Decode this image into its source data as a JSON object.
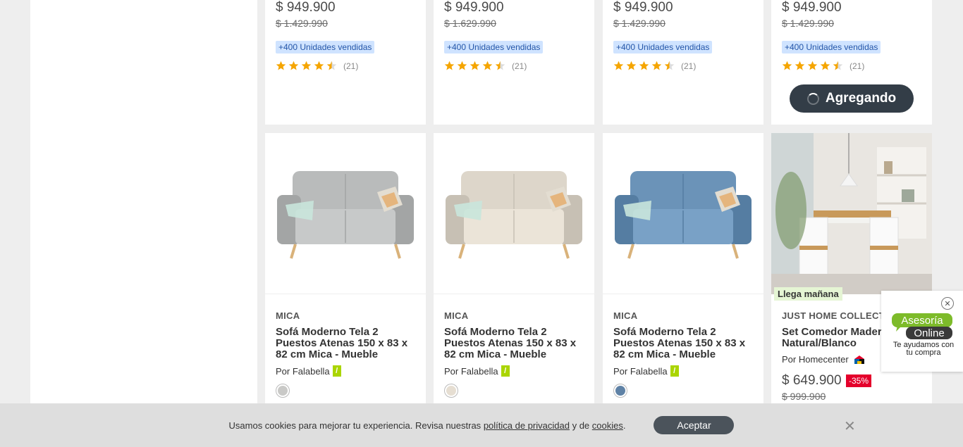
{
  "top_row": [
    {
      "price": "$ 949.900",
      "old_price": "$ 1.429.990",
      "sold_badge": "+400 Unidades vendidas",
      "reviews": "(21)"
    },
    {
      "price": "$ 949.900",
      "old_price": "$ 1.629.990",
      "sold_badge": "+400 Unidades vendidas",
      "reviews": "(21)"
    },
    {
      "price": "$ 949.900",
      "old_price": "$ 1.429.990",
      "sold_badge": "+400 Unidades vendidas",
      "reviews": "(21)"
    },
    {
      "price": "$ 949.900",
      "old_price": "$ 1.429.990",
      "sold_badge": "+400 Unidades vendidas",
      "reviews": "(21)",
      "button_label": "Agregando"
    }
  ],
  "rating": 4.5,
  "bottom_row": [
    {
      "brand": "MICA",
      "title": "Sofá Moderno Tela 2 Puestos Atenas 150 x 83 x 82 cm Mica - Mueble",
      "seller": "Por Falabella",
      "seller_logo": "/",
      "swatch_color": "#c9c9c7",
      "sofa_color": "#b9bbbb"
    },
    {
      "brand": "MICA",
      "title": "Sofá Moderno Tela 2 Puestos Atenas 150 x 83 x 82 cm Mica - Mueble",
      "seller": "Por Falabella",
      "seller_logo": "/",
      "swatch_color": "#e6ded2",
      "sofa_color": "#ddd6ca"
    },
    {
      "brand": "MICA",
      "title": "Sofá Moderno Tela 2 Puestos Atenas 150 x 83 x 82 cm Mica - Mueble",
      "seller": "Por Falabella",
      "seller_logo": "/",
      "swatch_color": "#5f82a6",
      "sofa_color": "#6b93b8"
    },
    {
      "brand": "JUST HOME COLLECTION",
      "title": "Set Comedor Madera Natural/Blanco",
      "seller": "Por Homecenter",
      "delivery": "Llega mañana",
      "price": "$ 649.900",
      "discount": "-35%",
      "old_price": "$ 999.900"
    }
  ],
  "cookie": {
    "text_before": "Usamos cookies para mejorar tu experiencia. Revisa nuestras",
    "privacy_link": "política de privacidad",
    "and": "y de",
    "cookies_link": "cookies",
    "period": ".",
    "accept_label": "Aceptar",
    "close": "✕"
  },
  "chat": {
    "close": "✕",
    "logo_line1": "Asesoría",
    "logo_line2": "Online",
    "text": "Te ayudamos con tu compra"
  },
  "colors": {
    "star": "#f5a500",
    "accent_green": "#aad500",
    "button_dark": "#333d47"
  }
}
